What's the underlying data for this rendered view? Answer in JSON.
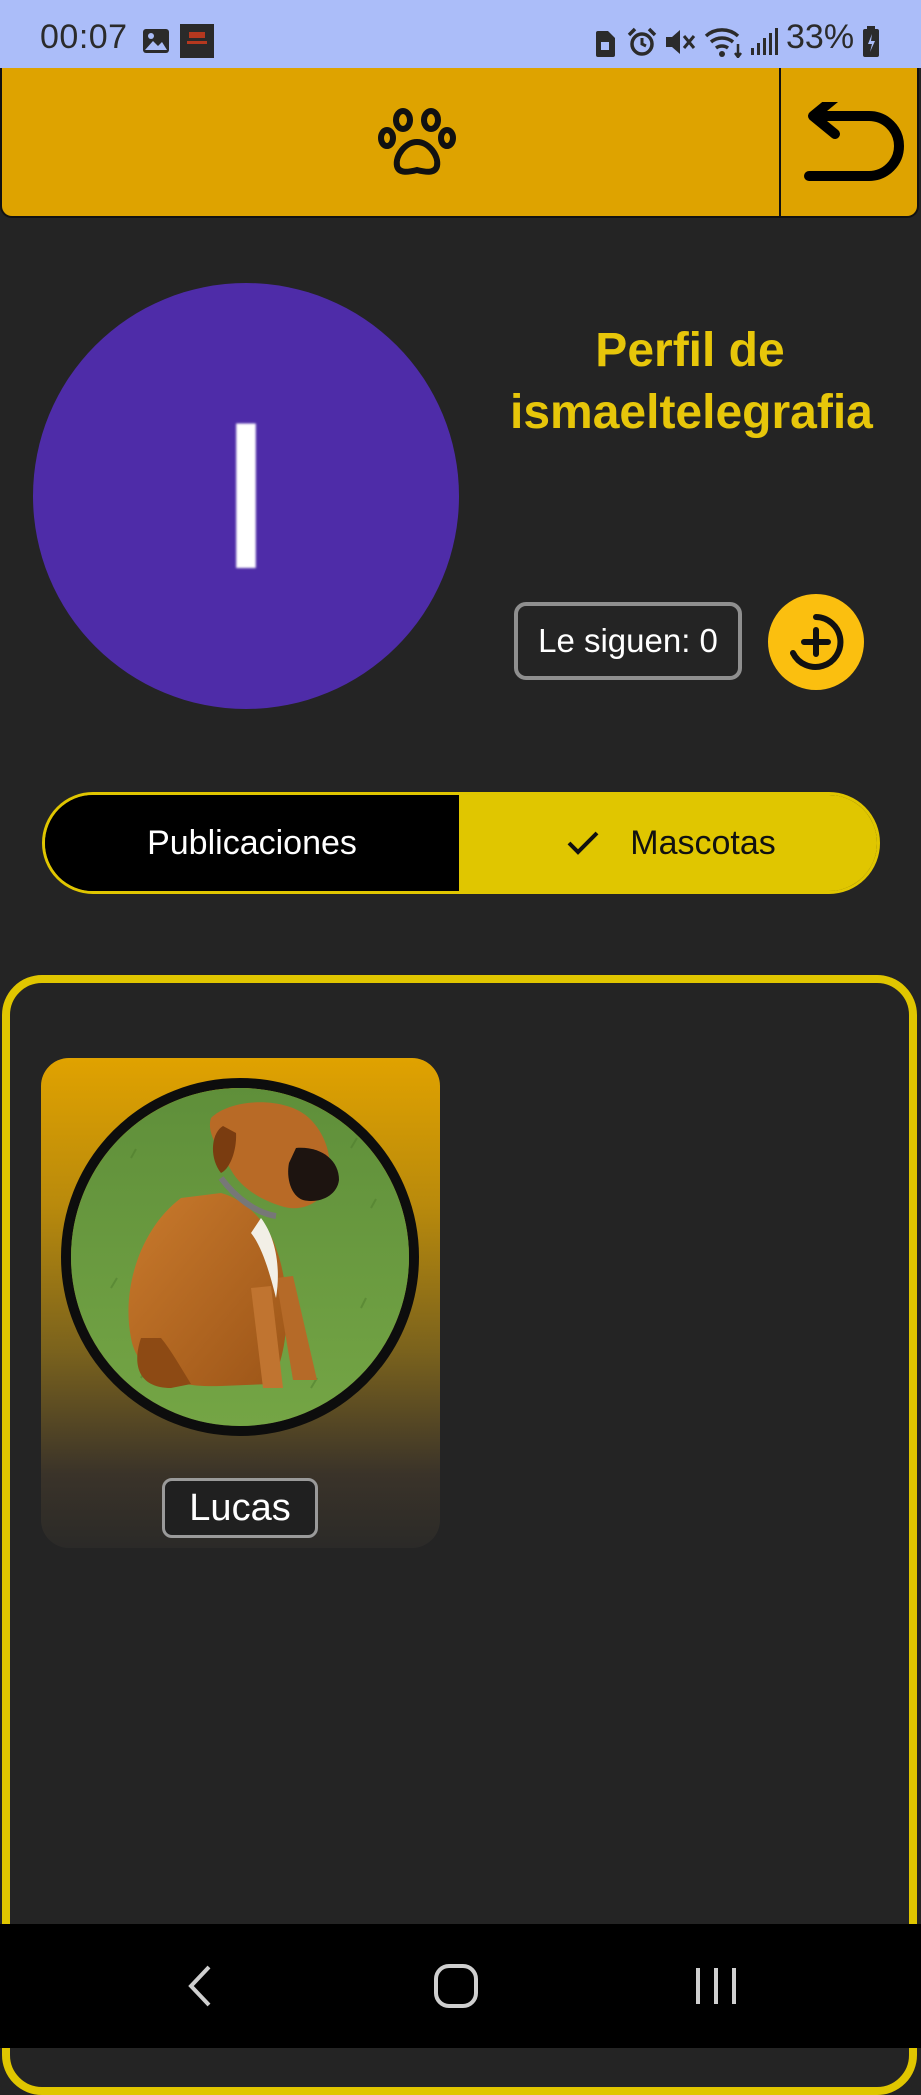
{
  "status_bar": {
    "time": "00:07",
    "battery_percent": "33%",
    "icons": [
      "gallery-icon",
      "app-thumbnail-icon",
      "sim-icon",
      "alarm-icon",
      "mute-icon",
      "wifi-icon",
      "signal-icon",
      "battery-icon"
    ]
  },
  "app_bar": {
    "logo_icon": "paw-icon",
    "back_icon": "back-arrow-icon",
    "color": "#dea300"
  },
  "profile": {
    "avatar_letter": "I",
    "avatar_color": "#4e2ca8",
    "title": "Perfil de ismaeltelegrafia",
    "followers_label": "Le siguen: 0",
    "follow_icon": "add-circle-icon"
  },
  "tabs": {
    "items": [
      {
        "label": "Publicaciones",
        "selected": false
      },
      {
        "label": "Mascotas",
        "selected": true
      }
    ],
    "accent": "#e0c600"
  },
  "pets": [
    {
      "name": "Lucas",
      "photo": "dog-photo"
    }
  ],
  "nav_bar": {
    "icons": [
      "back-nav-icon",
      "home-nav-icon",
      "recents-nav-icon"
    ]
  }
}
